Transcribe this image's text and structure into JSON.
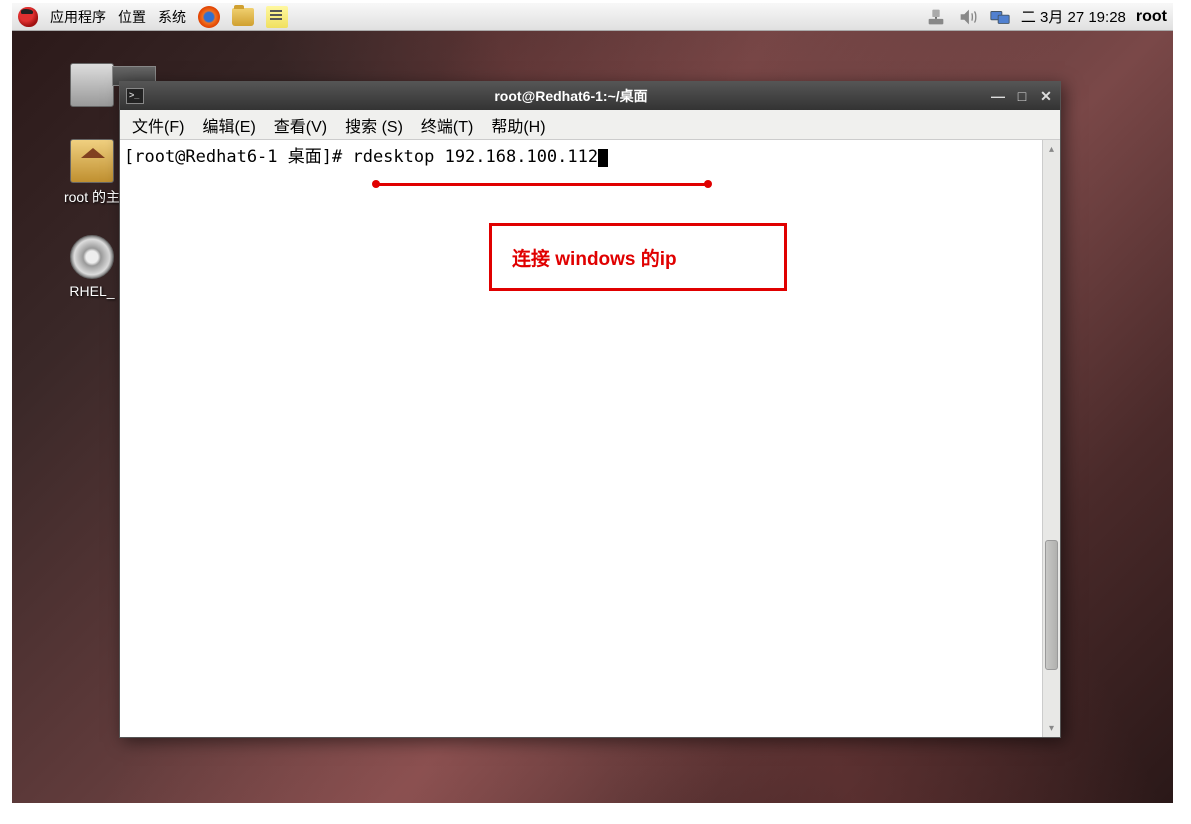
{
  "panel": {
    "menus": {
      "apps": "应用程序",
      "places": "位置",
      "system": "系统"
    },
    "clock": "二 3月 27 19:28",
    "user": "root"
  },
  "desktop": {
    "icons": {
      "computer": "",
      "home": "root 的主",
      "disc": "RHEL_"
    }
  },
  "terminal": {
    "title": "root@Redhat6-1:~/桌面",
    "menus": {
      "file": "文件(F)",
      "edit": "编辑(E)",
      "view": "查看(V)",
      "search": "搜索 (S)",
      "terminal": "终端(T)",
      "help": "帮助(H)"
    },
    "prompt": "[root@Redhat6-1 桌面]# ",
    "command": "rdesktop 192.168.100.112"
  },
  "annotation": {
    "text": "连接 windows 的ip"
  }
}
